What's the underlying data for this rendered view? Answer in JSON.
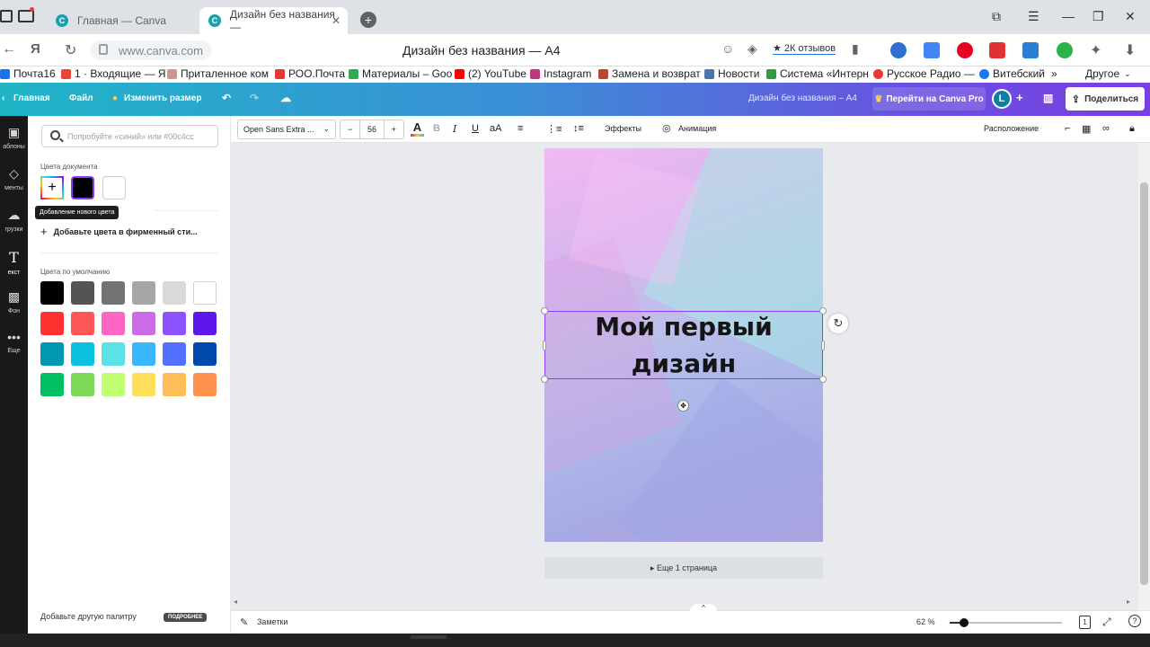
{
  "browser": {
    "tabs": [
      {
        "label": "Главная — Canva",
        "active": false
      },
      {
        "label": "Дизайн без названия — ",
        "active": true
      }
    ],
    "url": "www.canva.com",
    "page_title": "Дизайн без названия — A4",
    "reviews_label": "★ 2К отзывов",
    "bookmarks": [
      {
        "label": "Почта16",
        "color": "#1a73e8"
      },
      {
        "label": "1 · Входящие — Я",
        "color": "#ea4335"
      },
      {
        "label": "Приталенное ком",
        "color": "#c98"
      },
      {
        "label": "РОО.Почта",
        "color": "#e53935"
      },
      {
        "label": "Материалы – Goo",
        "color": "#34a853"
      },
      {
        "label": "(2) YouTube",
        "color": "#ff0000"
      },
      {
        "label": "Instagram",
        "color": "#c13584"
      },
      {
        "label": "Замена и возврат",
        "color": "#b43"
      },
      {
        "label": "Новости",
        "color": "#4a76a8"
      },
      {
        "label": "Система «Интерн",
        "color": "#2e9e3e"
      },
      {
        "label": "Русское Радио —",
        "color": "#e53935"
      },
      {
        "label": "Витебский",
        "color": "#1877f2"
      }
    ],
    "bookmarks_more": "»",
    "bookmarks_other": "Другое"
  },
  "header": {
    "home": "Главная",
    "file": "Файл",
    "resize": "Изменить размер",
    "design_title": "Дизайн без названия – A4",
    "pro_button": "Перейти на Canva Pro",
    "avatar_letter": "L",
    "share": "Поделиться"
  },
  "rail": {
    "items": [
      {
        "label": "аблоны",
        "icon": "templates-icon"
      },
      {
        "label": "менты",
        "icon": "elements-icon"
      },
      {
        "label": "грузки",
        "icon": "uploads-icon"
      },
      {
        "label": "екст",
        "icon": "text-icon"
      },
      {
        "label": "Фон",
        "icon": "background-icon"
      },
      {
        "label": "Еще",
        "icon": "more-icon"
      }
    ]
  },
  "panel": {
    "search_placeholder": "Попробуйте «синий» или #00c4cc",
    "doc_colors_label": "Цвета документа",
    "tooltip": "Добавление нового цвета",
    "brand_link": "Добавьте цвета в фирменный сти...",
    "default_colors_label": "Цвета по умолчанию",
    "default_colors": [
      "#000000",
      "#545454",
      "#737373",
      "#a6a6a6",
      "#d9d9d9",
      "#ffffff",
      "#ff3131",
      "#ff5757",
      "#ff66c4",
      "#cb6ce6",
      "#8c52ff",
      "#5e17eb",
      "#0097b2",
      "#0cc0df",
      "#5ce1e6",
      "#38b6ff",
      "#5271ff",
      "#004aad",
      "#00bf63",
      "#7ed957",
      "#c1ff72",
      "#ffde59",
      "#ffbd59",
      "#ff914d"
    ],
    "palette_footer": "Добавьте другую палитру",
    "more_button": "ПОДРОБНЕЕ"
  },
  "toolbar": {
    "font": "Open Sans Extra ...",
    "font_size": "56",
    "minus": "−",
    "plus": "+",
    "effects": "Эффекты",
    "animation": "Анимация",
    "position": "Расположение"
  },
  "canvas": {
    "text": "Мой первый\nдизайн",
    "more_pages": "▸ Еще 1 страница"
  },
  "footer": {
    "notes": "Заметки",
    "zoom": "62 %",
    "zoom_value": 0.13,
    "page_count": "1"
  }
}
